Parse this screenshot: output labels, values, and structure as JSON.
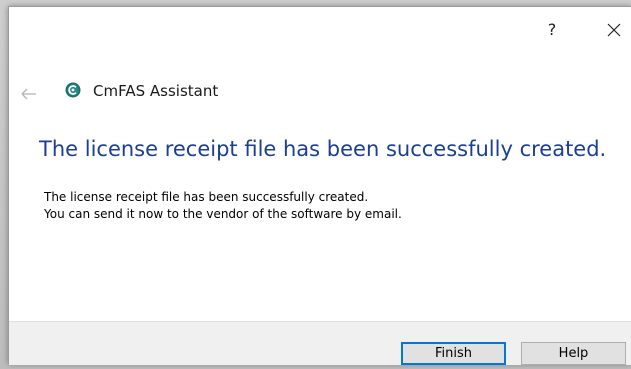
{
  "titlebar": {
    "help_label": "?",
    "close_icon": "close-icon"
  },
  "header": {
    "back_icon": "back-arrow-icon",
    "app_icon": "cmfas-logo-icon",
    "app_title": "CmFAS Assistant"
  },
  "main": {
    "heading": "The license receipt file has been successfully created.",
    "lines": [
      "The license receipt file has been successfully created.",
      "You can send it now to the vendor of the software by email."
    ]
  },
  "footer": {
    "finish_label": "Finish",
    "help_label": "Help"
  },
  "colors": {
    "heading": "#1c3f95",
    "primary_button_border": "#0078d7",
    "footer_bg": "#f0f0f0"
  }
}
